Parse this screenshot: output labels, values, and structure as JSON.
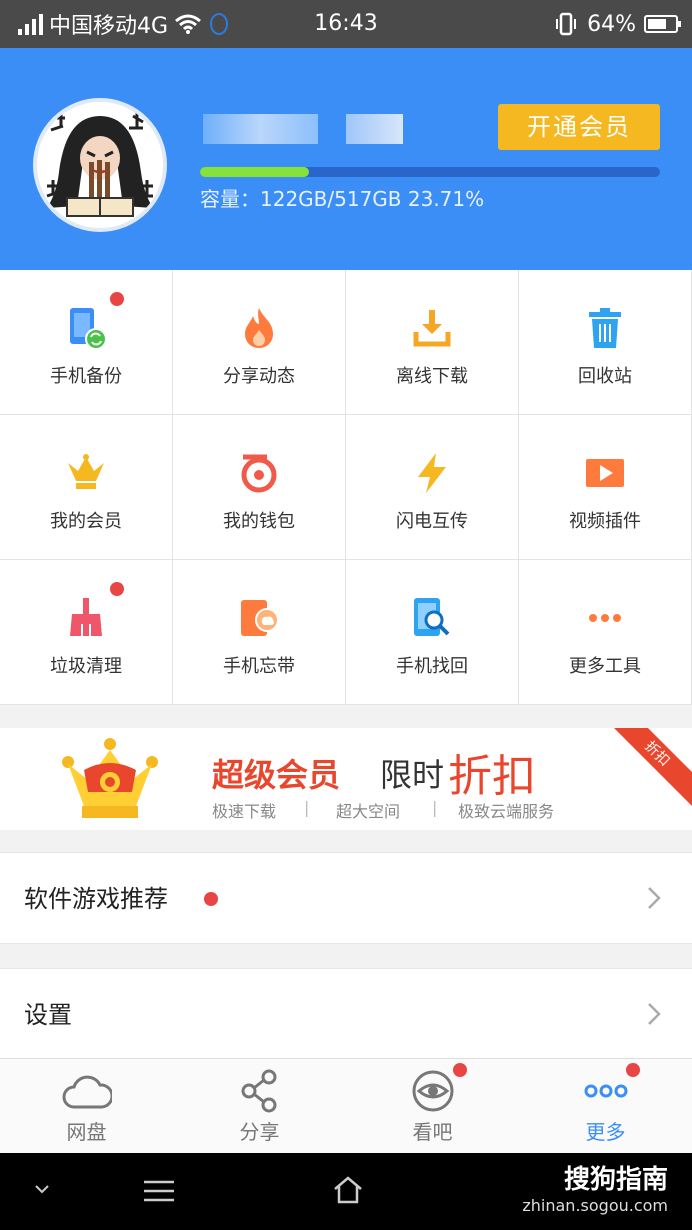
{
  "status_bar": {
    "carrier": "中国移动4G",
    "time": "16:43",
    "battery": "64%"
  },
  "header": {
    "vip_button": "开通会员",
    "capacity": "容量：122GB/517GB 23.71%",
    "usage_fraction": 0.2371
  },
  "tools": [
    {
      "label": "手机备份",
      "icon": "phone-backup-icon",
      "badge": true
    },
    {
      "label": "分享动态",
      "icon": "flame-icon",
      "badge": false
    },
    {
      "label": "离线下载",
      "icon": "download-tray-icon",
      "badge": false
    },
    {
      "label": "回收站",
      "icon": "trash-icon",
      "badge": false
    },
    {
      "label": "我的会员",
      "icon": "crown-icon",
      "badge": false
    },
    {
      "label": "我的钱包",
      "icon": "wallet-icon",
      "badge": false
    },
    {
      "label": "闪电互传",
      "icon": "lightning-icon",
      "badge": false
    },
    {
      "label": "视频插件",
      "icon": "video-play-icon",
      "badge": false
    },
    {
      "label": "垃圾清理",
      "icon": "broom-icon",
      "badge": true
    },
    {
      "label": "手机忘带",
      "icon": "phone-cloud-icon",
      "badge": false
    },
    {
      "label": "手机找回",
      "icon": "phone-search-icon",
      "badge": false
    },
    {
      "label": "更多工具",
      "icon": "more-dots-icon",
      "badge": false
    }
  ],
  "promo": {
    "title": "超级会员",
    "limited": "限时",
    "discount": "折扣",
    "features": [
      "极速下载",
      "超大空间",
      "极致云端服务"
    ],
    "separator": "|",
    "ribbon": "折扣"
  },
  "list": {
    "recommend": "软件游戏推荐",
    "settings": "设置"
  },
  "tabs": [
    {
      "label": "网盘",
      "icon": "cloud-icon",
      "badge": false,
      "active": false
    },
    {
      "label": "分享",
      "icon": "share-icon",
      "badge": false,
      "active": false
    },
    {
      "label": "看吧",
      "icon": "eye-icon",
      "badge": true,
      "active": false
    },
    {
      "label": "更多",
      "icon": "more-dots-icon",
      "badge": true,
      "active": true
    }
  ],
  "watermark": {
    "brand": "搜狗指南",
    "url": "zhinan.sogou.com"
  },
  "colors": {
    "header_blue": "#3b8ef5",
    "vip_gold": "#f5b820",
    "badge_red": "#e84545",
    "promo_red": "#e8472e"
  }
}
